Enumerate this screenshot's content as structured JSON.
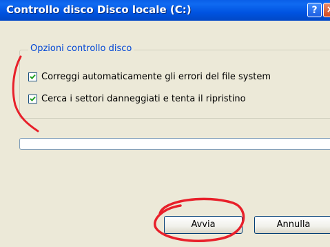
{
  "window": {
    "title": "Controllo disco Disco locale (C:)",
    "help_glyph": "?",
    "close_glyph": "×"
  },
  "options": {
    "group_label": "Opzioni controllo disco",
    "items": [
      {
        "label": "Correggi automaticamente gli errori del file system",
        "checked": true
      },
      {
        "label": "Cerca i settori danneggiati e tenta il ripristino",
        "checked": true
      }
    ]
  },
  "progress": {
    "value": 0
  },
  "buttons": {
    "start": "Avvia",
    "cancel": "Annulla"
  },
  "colors": {
    "titlebar": "#0054E3",
    "group_label": "#0046D5",
    "annotation": "#E8202A"
  }
}
